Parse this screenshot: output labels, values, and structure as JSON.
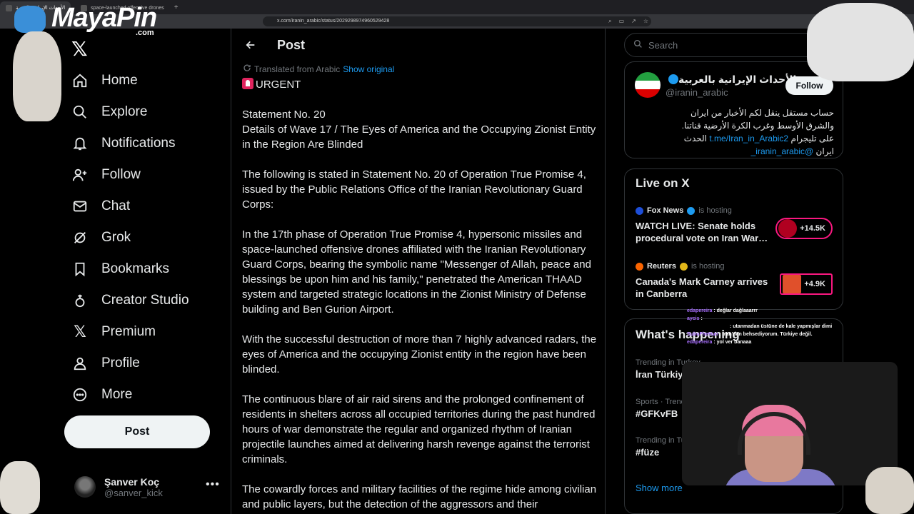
{
  "browser": {
    "tabs": [
      {
        "label": "الأحداث الإيرانية بالعربية",
        "active": true
      },
      {
        "label": "space-launched offensive drones",
        "active": false
      }
    ],
    "url": "x.com/iranin_arabic/status/2029298974960529428"
  },
  "watermark": {
    "brand": "MayaPin",
    "suffix": ".com"
  },
  "nav": {
    "items": [
      {
        "label": "Home",
        "icon": "home-icon"
      },
      {
        "label": "Explore",
        "icon": "search-icon"
      },
      {
        "label": "Notifications",
        "icon": "bell-icon"
      },
      {
        "label": "Follow",
        "icon": "person-plus-icon"
      },
      {
        "label": "Chat",
        "icon": "mail-icon"
      },
      {
        "label": "Grok",
        "icon": "grok-icon"
      },
      {
        "label": "Bookmarks",
        "icon": "bookmark-icon"
      },
      {
        "label": "Creator Studio",
        "icon": "creator-studio-icon"
      },
      {
        "label": "Premium",
        "icon": "x-premium-icon"
      },
      {
        "label": "Profile",
        "icon": "person-icon"
      },
      {
        "label": "More",
        "icon": "more-circle-icon"
      }
    ],
    "post_button": "Post",
    "account": {
      "name": "Şanver Koç",
      "handle": "@sanver_kick"
    }
  },
  "post": {
    "header_title": "Post",
    "translated_label": "Translated from Arabic",
    "show_original": "Show original",
    "urgent": "URGENT",
    "statement_lines": [
      "Statement No. 20",
      "Details of Wave 17 / The Eyes of America and the Occupying Zionist Entity in the Region Are Blinded"
    ],
    "paragraphs": [
      "The following is stated in Statement No. 20 of Operation True Promise 4, issued by the Public Relations Office of the Iranian Revolutionary Guard Corps:",
      "In the 17th phase of Operation True Promise 4, hypersonic missiles and space-launched offensive drones affiliated with the Iranian Revolutionary Guard Corps, bearing the symbolic name \"Messenger of Allah, peace and blessings be upon him and his family,\" penetrated the American THAAD system and targeted strategic locations in the Zionist Ministry of Defense building and Ben Gurion Airport.",
      "With the successful destruction of more than 7 highly advanced radars, the eyes of America and the occupying Zionist entity in the region have been blinded.",
      "The continuous blare of air raid sirens and the prolonged confinement of residents in shelters across all occupied territories during the past hundred hours of war demonstrate the regular and organized rhythm of Iranian projectile launches aimed at delivering harsh revenge against the terrorist criminals.",
      "The cowardly forces and military facilities of the regime hide among civilian and public layers, but the detection of the aggressors and their"
    ]
  },
  "right": {
    "search_placeholder": "Search",
    "profile_card": {
      "name": "الأحداث الإيرانية بالعربية",
      "handle": "@iranin_arabic",
      "follow_label": "Follow",
      "bio_lines": [
        "حساب مستقل ينقل لكم الأخبار من ايران",
        "والشرق الأوسط وغرب الكرة الأرضية قناتنا.",
        "على تليجرام"
      ],
      "bio_link": "t.me/Iran_in_Arabic2",
      "bio_tail": "الحدث",
      "bio_line4_prefix": "ايران",
      "bio_mention": "@iranin_arabic_"
    },
    "live": {
      "title": "Live on X",
      "items": [
        {
          "host": "Fox News",
          "status": "is hosting",
          "headline": "WATCH LIVE: Senate holds procedural vote on Iran War…",
          "count": "+14.5K"
        },
        {
          "host": "Reuters",
          "status": "is hosting",
          "headline": "Canada's Mark Carney arrives in Canberra",
          "count": "+4.9K"
        }
      ]
    },
    "trends": {
      "title": "What's happening",
      "items": [
        {
          "meta": "Trending in Turkey",
          "name": "İran Türkiye"
        },
        {
          "meta": "Sports · Trending",
          "name": "#GFKvFB"
        },
        {
          "meta": "Trending in Turkey",
          "name": "#füze"
        }
      ],
      "show_more": "Show more"
    }
  },
  "stream_chat": [
    {
      "user": "edapereira",
      "text": ": değlar dağlaaarrr"
    },
    {
      "user": "aycis",
      "text": ":"
    },
    {
      "user": "",
      "text": ": utanmadan üstüne de kale yapmışlar dimi"
    },
    {
      "user": "SubuFheHun",
      "text": ": iran'dan behsediyorum. Türkiye değil."
    },
    {
      "user": "edapereira",
      "text": ": yol ver banaaa"
    }
  ],
  "colors": {
    "accent": "#1d9bf0",
    "live_pill": "#f91880",
    "background": "#000000"
  }
}
